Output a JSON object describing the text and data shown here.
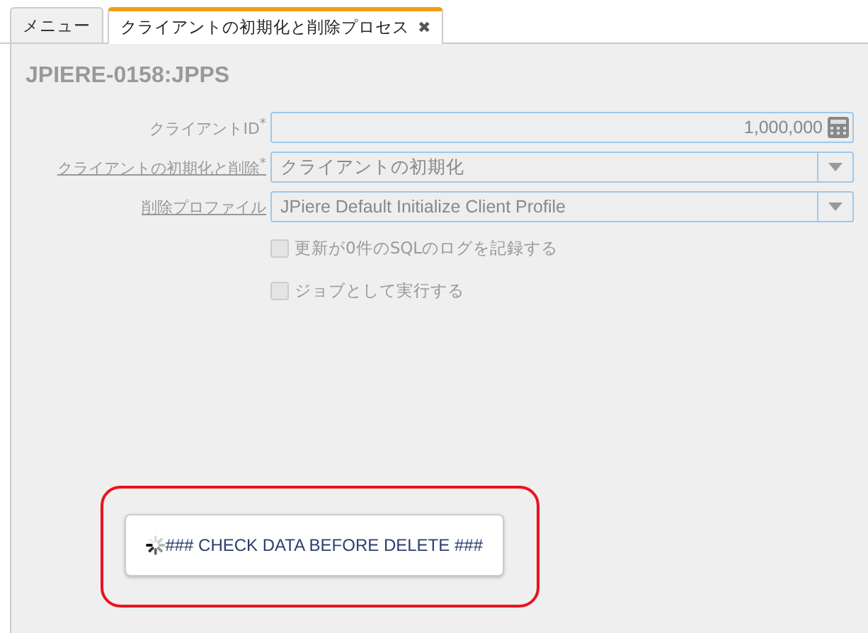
{
  "tabs": [
    {
      "label": "メニュー",
      "selected": false,
      "closable": false
    },
    {
      "label": "クライアントの初期化と削除プロセス",
      "selected": true,
      "closable": true,
      "close": "✖"
    }
  ],
  "title": "JPIERE-0158:JPPS",
  "fields": [
    {
      "kind": "number",
      "label": "クライアントID$^{*}$",
      "link": false,
      "value": "1,000,000"
    },
    {
      "kind": "select",
      "label": "クライアントの初期化と削除$^{*}$",
      "link": true,
      "value": "クライアントの初期化"
    },
    {
      "kind": "select",
      "label": "削除プロファイル",
      "link": true,
      "value": "JPiere Default Initialize Client Profile"
    }
  ],
  "checkboxes": [
    {
      "label": "更新が0件のSQLのログを記録する",
      "checked": false,
      "disabled": true
    },
    {
      "label": "ジョブとして実行する",
      "checked": false,
      "disabled": true
    }
  ],
  "button": {
    "label": "### CHECK DATA BEFORE DELETE ###",
    "busy": true
  },
  "highlight": {
    "on": true,
    "color": "#e8141c"
  }
}
